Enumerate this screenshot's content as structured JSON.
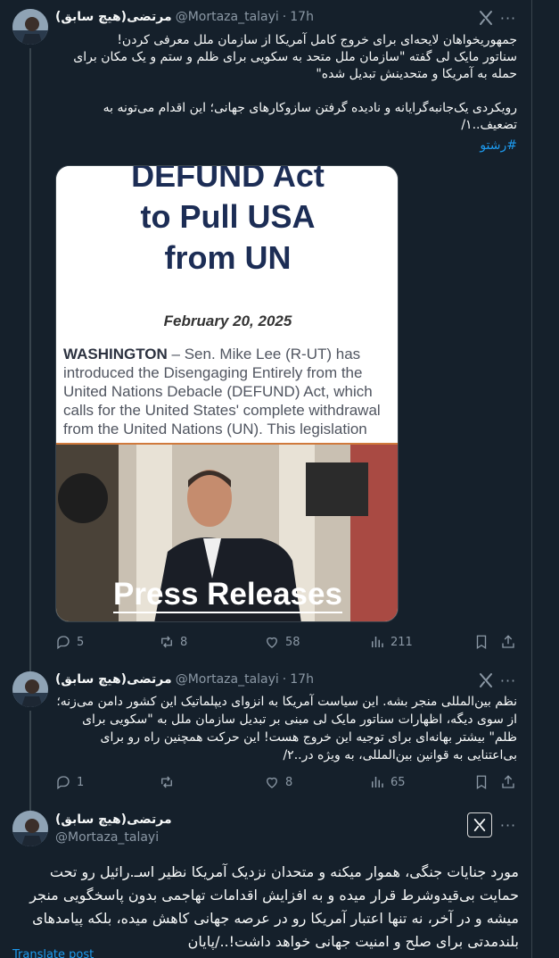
{
  "author": {
    "name": "مرتضی(هیچ سابق)",
    "handle": "@Mortaza_talayi"
  },
  "icons": {
    "grok": "grok-icon",
    "more": "more-icon",
    "reply": "reply-icon",
    "repost": "repost-icon",
    "like": "like-icon",
    "views": "views-icon",
    "bookmark": "bookmark-icon",
    "share": "share-icon"
  },
  "colors": {
    "background": "#15202b",
    "accent": "#1d9bf0",
    "muted": "#8b98a5"
  },
  "posts": [
    {
      "time": "17h",
      "more": "···",
      "text": "جمهوریخواهان لایحه‌ای برای خروج کامل آمریکا از سازمان ملل معرفی کردن!\nسناتور مایک لی گفته \"سازمان ملل متحد به سکویی برای ظلم و ستم و یک مکان برای حمله به آمریکا و متحدینش تبدیل شده\"\n\nرویکردی یک‌جانبه‌گرایانه و نادیده گرفتن سازوکارهای جهانی؛ این اقدام می‌تونه به تضعیف..١/",
      "hashtag": "#رشتو",
      "media": {
        "title_lines": [
          "DEFUND Act",
          "to Pull USA",
          "from UN"
        ],
        "date": "February 20, 2025",
        "dateline": "WASHINGTON",
        "body": " – Sen. Mike Lee (R-UT) has introduced the Disengaging Entirely from the United Nations Debacle (DEFUND) Act, which calls for the United States' complete withdrawal from the United Nations (UN). This legislation",
        "caption": "Press Releases"
      },
      "stats": {
        "replies": "5",
        "reposts": "8",
        "likes": "58",
        "views": "211"
      }
    },
    {
      "time": "17h",
      "more": "···",
      "text": "نظم بین‌المللی منجر بشه. این سیاست آمریکا به انزوای دیپلماتیک این کشور دامن می‌زنه؛ از سوی دیگه، اظهارات سناتور مایک لی مبنی بر تبدیل سازمان ملل به \"سکویی برای ظلم\" بیشتر بهانه‌ای برای توجیه این خروج هست! این حرکت همچنین راه رو برای بی‌اعتنایی به قوانین بین‌المللی، به ویژه در..٢/",
      "stats": {
        "replies": "1",
        "reposts": "",
        "likes": "8",
        "views": "65"
      }
    },
    {
      "more": "···",
      "text": "مورد جنایات جنگی، هموار میکنه و متحدان نزدیک آمریکا نظیر اسـ.رائیل رو تحت حمایت بی‌قیدوشرط قرار میده و به افزایش اقدامات تهاجمی بدون پاسخگویی منجر میشه و در آخر، نه تنها اعتبار آمریکا رو در عرصه جهانی کاهش میده، بلکه پیامدهای بلندمدتی برای صلح و امنیت جهانی خواهد داشت!../پایان",
      "translate": "Translate post"
    }
  ]
}
